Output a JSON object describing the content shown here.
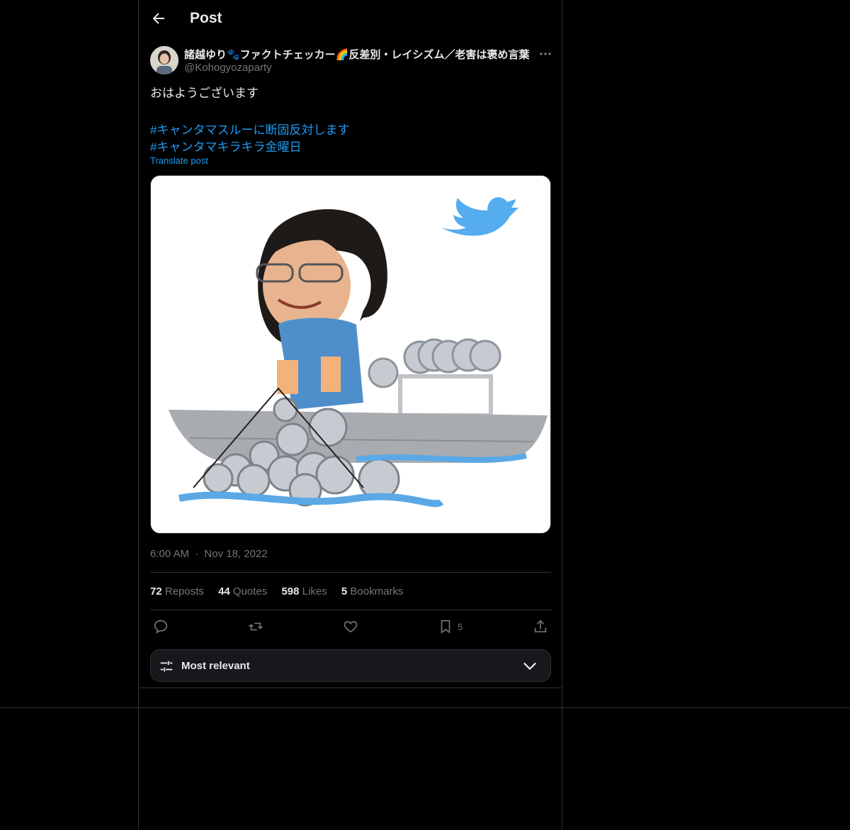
{
  "header": {
    "title": "Post"
  },
  "tweet": {
    "author_name": "諸越ゆり🐾ファクトチェッカー🌈反差別・レイシズム／老害は褒め言葉",
    "author_handle": "@Kohogyozaparty",
    "text": "おはようございます",
    "hashtags": [
      "#キャンタマスルーに断固反対します",
      "#キャンタマキラキラ金曜日"
    ],
    "translate_label": "Translate post",
    "timestamp": "6:00 AM",
    "dot": "·",
    "date": "Nov 18, 2022"
  },
  "stats": {
    "reposts": {
      "count": "72",
      "label": "Reposts"
    },
    "quotes": {
      "count": "44",
      "label": "Quotes"
    },
    "likes": {
      "count": "598",
      "label": "Likes"
    },
    "bookmarks": {
      "count": "5",
      "label": "Bookmarks"
    }
  },
  "actions": {
    "bookmark_count": "5",
    "icons": [
      "reply-icon",
      "repost-icon",
      "like-icon",
      "bookmark-icon",
      "share-icon"
    ]
  },
  "sort": {
    "label": "Most relevant"
  },
  "colors": {
    "accent": "#1d9bf0",
    "background": "#000000",
    "secondary_text": "#71767b",
    "border": "#2f3336"
  }
}
